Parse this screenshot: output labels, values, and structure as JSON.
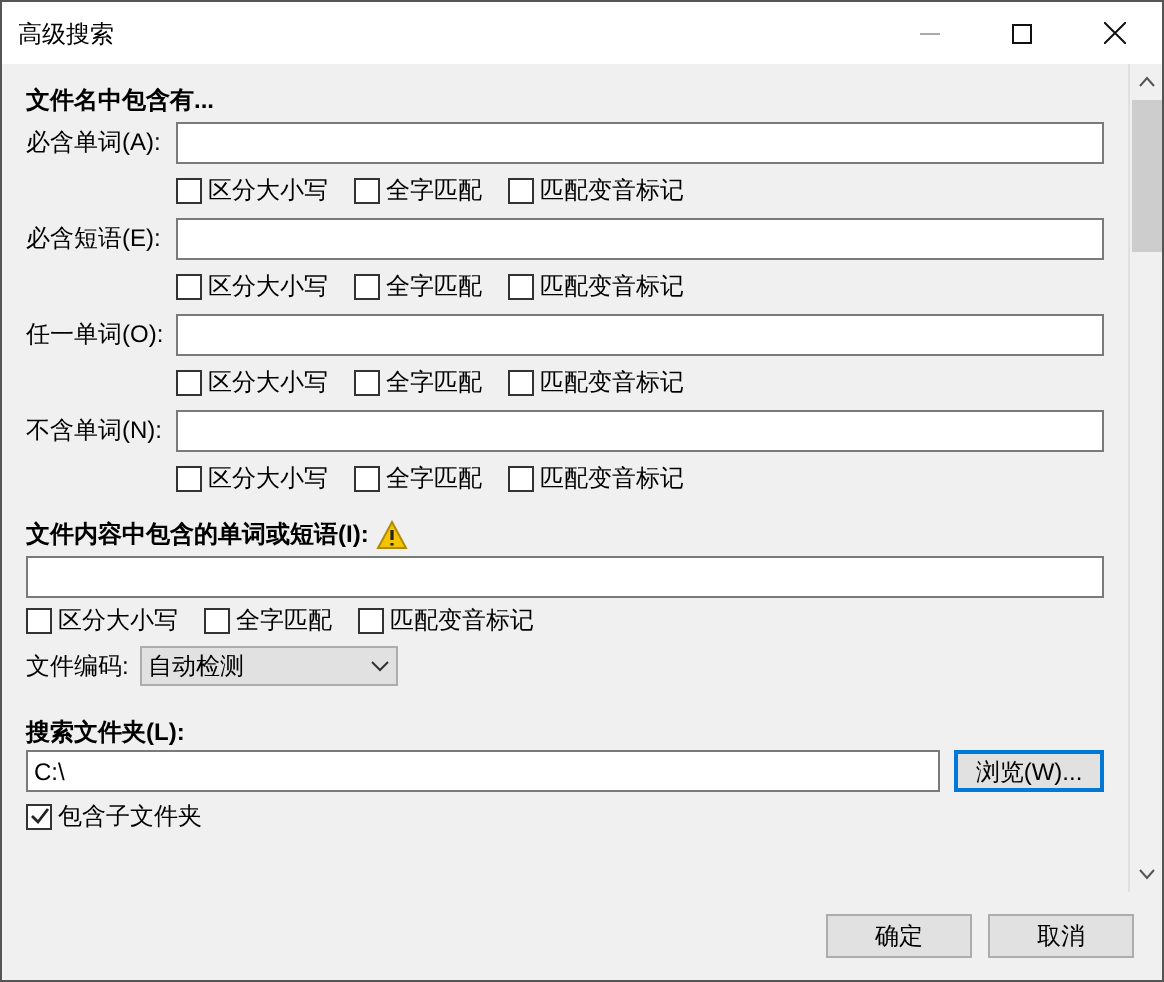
{
  "window": {
    "title": "高级搜索"
  },
  "filename_section": {
    "heading": "文件名中包含有...",
    "rows": [
      {
        "label": "必含单词(A):",
        "options": [
          {
            "label": "区分大小写",
            "checked": false
          },
          {
            "label": "全字匹配",
            "checked": false
          },
          {
            "label": "匹配变音标记",
            "checked": false
          }
        ]
      },
      {
        "label": "必含短语(E):",
        "options": [
          {
            "label": "区分大小写",
            "checked": false
          },
          {
            "label": "全字匹配",
            "checked": false
          },
          {
            "label": "匹配变音标记",
            "checked": false
          }
        ]
      },
      {
        "label": "任一单词(O):",
        "options": [
          {
            "label": "区分大小写",
            "checked": false
          },
          {
            "label": "全字匹配",
            "checked": false
          },
          {
            "label": "匹配变音标记",
            "checked": false
          }
        ]
      },
      {
        "label": "不含单词(N):",
        "options": [
          {
            "label": "区分大小写",
            "checked": false
          },
          {
            "label": "全字匹配",
            "checked": false
          },
          {
            "label": "匹配变音标记",
            "checked": false
          }
        ]
      }
    ]
  },
  "content_section": {
    "heading": "文件内容中包含的单词或短语(I):",
    "options": [
      {
        "label": "区分大小写",
        "checked": false
      },
      {
        "label": "全字匹配",
        "checked": false
      },
      {
        "label": "匹配变音标记",
        "checked": false
      }
    ],
    "encoding": {
      "label": "文件编码:",
      "value": "自动检测"
    }
  },
  "folder_section": {
    "heading": "搜索文件夹(L):",
    "value": "C:\\",
    "browse_button": "浏览(W)...",
    "subfolders": {
      "label": "包含子文件夹",
      "checked": true
    }
  },
  "buttons": [
    {
      "label": "确定"
    },
    {
      "label": "取消"
    }
  ]
}
